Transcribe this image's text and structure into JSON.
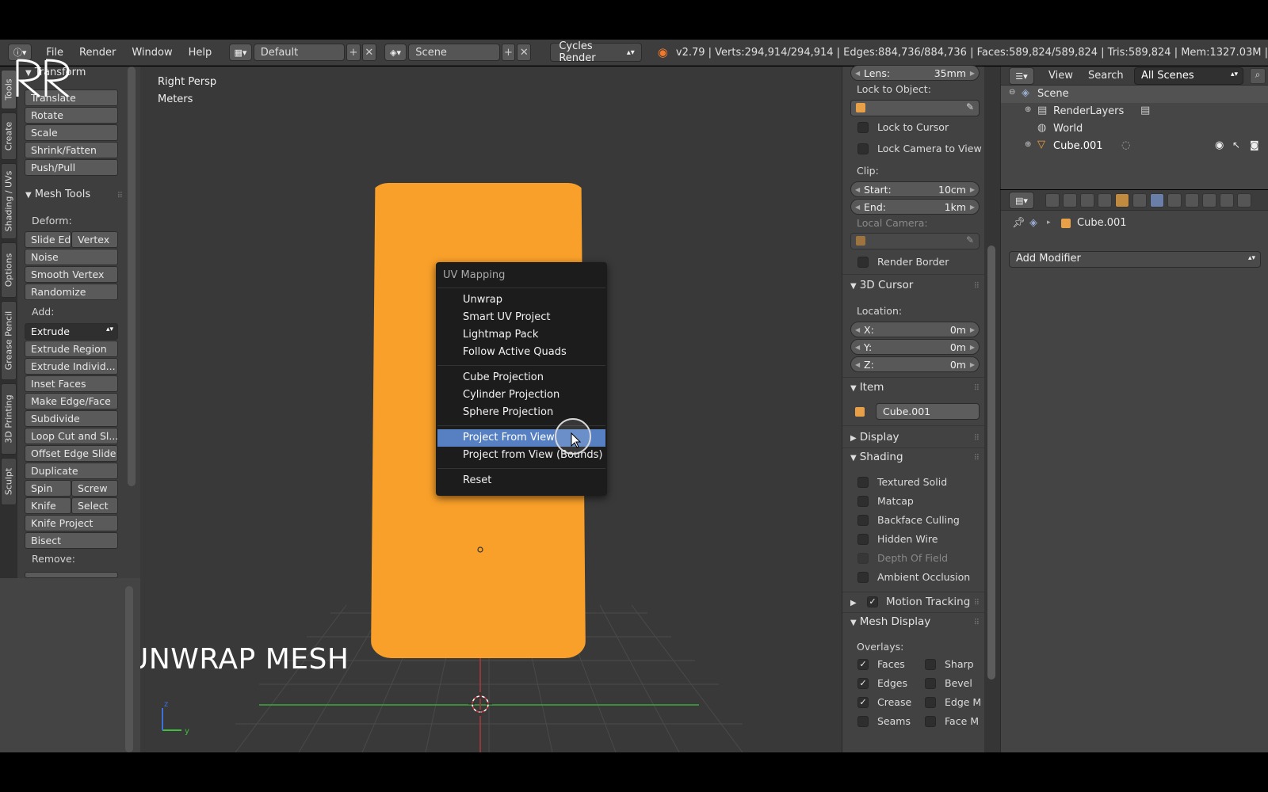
{
  "header": {
    "menus": [
      "File",
      "Render",
      "Window",
      "Help"
    ],
    "layout": "Default",
    "scene": "Scene",
    "render_engine": "Cycles Render",
    "stats": "v2.79 | Verts:294,914/294,914 | Edges:884,736/884,736 | Faces:589,824/589,824 | Tris:589,824 | Mem:1327.03M |"
  },
  "left_tabs": [
    "Tools",
    "Create",
    "Shading / UVs",
    "Options",
    "Grease Pencil",
    "3D Printing",
    "Sculpt"
  ],
  "toolshelf": {
    "transform_header": "Transform",
    "transform": [
      "Translate",
      "Rotate",
      "Scale",
      "Shrink/Fatten",
      "Push/Pull"
    ],
    "mesh_tools_header": "Mesh Tools",
    "deform_label": "Deform:",
    "slide_edge": "Slide Ed",
    "vertex": "Vertex",
    "deform": [
      "Noise",
      "Smooth Vertex",
      "Randomize"
    ],
    "add_label": "Add:",
    "extrude": "Extrude",
    "add": [
      "Extrude Region",
      "Extrude Individ...",
      "Inset Faces",
      "Make Edge/Face",
      "Subdivide",
      "Loop Cut and Sl...",
      "Offset Edge Slide",
      "Duplicate"
    ],
    "spin": "Spin",
    "screw": "Screw",
    "knife": "Knife",
    "select": "Select",
    "knife_project": "Knife Project",
    "bisect": "Bisect",
    "remove_label": "Remove:"
  },
  "viewport": {
    "view_name": "Right Persp",
    "units": "Meters",
    "overlay_title": "UNWRAP MESH",
    "mesh_color": "#f9a02a",
    "axis_y": "y",
    "axis_z": "z"
  },
  "uv_menu": {
    "title": "UV Mapping",
    "group1": [
      "Unwrap",
      "Smart UV Project",
      "Lightmap Pack",
      "Follow Active Quads"
    ],
    "group2": [
      "Cube Projection",
      "Cylinder Projection",
      "Sphere Projection"
    ],
    "group3": [
      "Project From View",
      "Project from View (Bounds)"
    ],
    "group4": [
      "Reset"
    ],
    "highlighted": "Project From View",
    "highlight_color": "#5680c2"
  },
  "properties": {
    "lens_label": "Lens:",
    "lens_value": "35mm",
    "lock_to_object": "Lock to Object:",
    "lock_to_cursor": "Lock to Cursor",
    "lock_camera_to_view": "Lock Camera to View",
    "clip": "Clip:",
    "start_label": "Start:",
    "start_value": "10cm",
    "end_label": "End:",
    "end_value": "1km",
    "local_camera": "Local Camera:",
    "render_border": "Render Border",
    "cursor_header": "3D Cursor",
    "location": "Location:",
    "x_label": "X:",
    "x_value": "0m",
    "y_label": "Y:",
    "y_value": "0m",
    "z_label": "Z:",
    "z_value": "0m",
    "item_header": "Item",
    "item_name": "Cube.001",
    "display_header": "Display",
    "shading_header": "Shading",
    "shading_options": [
      "Textured Solid",
      "Matcap",
      "Backface Culling",
      "Hidden Wire",
      "Depth Of Field",
      "Ambient Occlusion"
    ],
    "motion_tracking": "Motion Tracking",
    "mesh_display_header": "Mesh Display",
    "overlays_label": "Overlays:",
    "overlays_left": [
      "Faces",
      "Edges",
      "Crease",
      "Seams"
    ],
    "overlays_right": [
      "Sharp",
      "Bevel",
      "Edge M",
      "Face M"
    ]
  },
  "outliner": {
    "view": "View",
    "search": "Search",
    "filter": "All Scenes",
    "rows": [
      "Scene",
      "RenderLayers",
      "World",
      "Cube.001"
    ]
  },
  "modifiers": {
    "object": "Cube.001",
    "add_modifier": "Add Modifier"
  }
}
